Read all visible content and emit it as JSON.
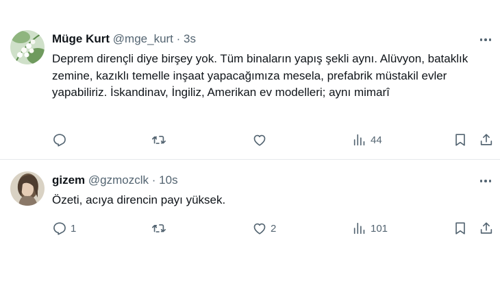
{
  "tweets": [
    {
      "name": "Müge Kurt",
      "handle": "@mge_kurt",
      "separator": "·",
      "time": "3s",
      "avatar_icon": "lily-of-the-valley-photo",
      "text": "Deprem dirençli diye birşey yok. Tüm binaların yapış şekli aynı.  Alüvyon, bataklık zemine, kazıklı temelle inşaat yapacağımıza mesela, prefabrik müstakil evler yapabiliriz. İskandinav, İngiliz, Amerikan ev modelleri; aynı mimarî",
      "replies": "",
      "retweets": "",
      "likes": "",
      "views": "44"
    },
    {
      "name": "gizem",
      "handle": "@gzmozclk",
      "separator": "·",
      "time": "10s",
      "avatar_icon": "woman-portrait-photo",
      "text": "Özeti, acıya direncin payı yüksek.",
      "replies": "1",
      "retweets": "",
      "likes": "2",
      "views": "101"
    }
  ],
  "colors": {
    "text": "#0f1419",
    "secondary": "#536471",
    "divider": "#e6e9ec"
  }
}
